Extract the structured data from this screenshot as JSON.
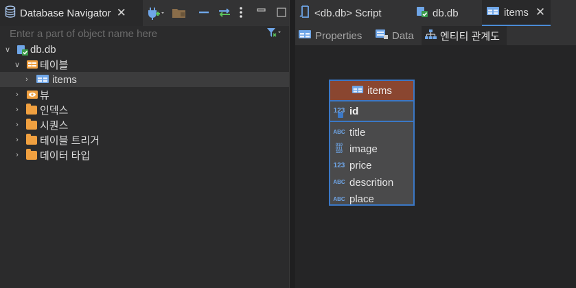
{
  "navigator": {
    "title": "Database Navigator",
    "filter_placeholder": "Enter a part of object name here",
    "tree": [
      {
        "label": "db.db",
        "icon": "sqlite-db-icon",
        "expanded": true
      },
      {
        "label": "테이블",
        "icon": "tables-folder-icon",
        "expanded": true
      },
      {
        "label": "items",
        "icon": "table-icon",
        "expanded": false,
        "selected": true
      },
      {
        "label": "뷰",
        "icon": "views-icon",
        "expanded": false
      },
      {
        "label": "인덱스",
        "icon": "folder-icon",
        "expanded": false
      },
      {
        "label": "시퀀스",
        "icon": "folder-icon",
        "expanded": false
      },
      {
        "label": "테이블 트리거",
        "icon": "folder-icon",
        "expanded": false
      },
      {
        "label": "데이터 타입",
        "icon": "folder-icon",
        "expanded": false
      }
    ]
  },
  "editor": {
    "tabs": [
      {
        "label": "<db.db> Script",
        "icon": "script-icon"
      },
      {
        "label": "db.db",
        "icon": "sqlite-db-icon"
      },
      {
        "label": "items",
        "icon": "table-icon",
        "active": true
      }
    ],
    "subtabs": [
      {
        "label": "Properties",
        "icon": "properties-icon"
      },
      {
        "label": "Data",
        "icon": "data-icon"
      },
      {
        "label": "엔티티 관계도",
        "icon": "er-diagram-icon",
        "active": true
      }
    ]
  },
  "entity": {
    "name": "items",
    "primary_key": {
      "name": "id",
      "type_icon": "123"
    },
    "columns": [
      {
        "name": "title",
        "type_icon": "ABC"
      },
      {
        "name": "image",
        "type_icon": "binary"
      },
      {
        "name": "price",
        "type_icon": "123"
      },
      {
        "name": "descrition",
        "type_icon": "ABC"
      },
      {
        "name": "place",
        "type_icon": "ABC"
      }
    ]
  },
  "colors": {
    "accent": "#3b78c6",
    "entity_header": "#8a4630",
    "folder": "#f0a040",
    "background": "#2b2b2c"
  }
}
